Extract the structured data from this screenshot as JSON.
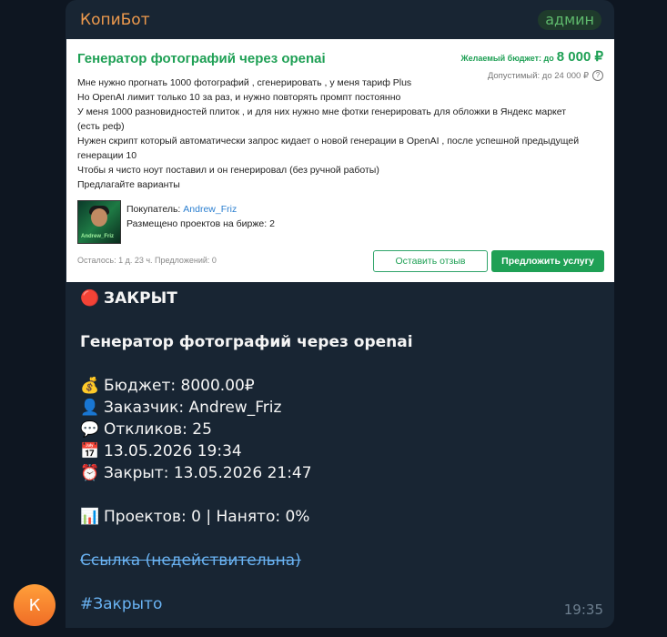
{
  "sender": {
    "name": "КопиБот",
    "badge": "админ",
    "avatar_letter": "К"
  },
  "card": {
    "title": "Генератор фотографий через openai",
    "budget_label": "Желаемый бюджет: до",
    "budget_value": "8 000 ₽",
    "allowed": "Допустимый: до 24 000 ₽",
    "help_icon": "?",
    "description": [
      "Мне нужно прогнать 1000 фотографий , сгенерировать , у меня тариф Plus",
      "Но OpenAI лимит только 10 за раз, и нужно повторять промпт постоянно",
      "У меня 1000 разновидностей плиток , и для них нужно мне фотки генерировать для обложки в Яндекс маркет",
      "(есть реф)",
      "Нужен скрипт который автоматически запрос кидает о новой генерации в OpenAI , после успешной предыдущей",
      "генерации 10",
      "Чтобы я чисто ноут поставил и он генерировал (без ручной работы)",
      "Предлагайте варианты"
    ],
    "buyer_label": "Покупатель: ",
    "buyer_name": "Andrew_Friz",
    "buyer_projects": "Размещено проектов на бирже: 2",
    "avatar_tag": "Andrew_Friz",
    "footer_meta": "Осталось: 1 д. 23 ч.   Предложений: 0",
    "btn_review": "Оставить отзыв",
    "btn_offer": "Предложить услугу"
  },
  "message": {
    "status_emoji": "🔴",
    "status": "ЗАКРЫТ",
    "title": "Генератор фотографий через openai",
    "lines": [
      {
        "emoji": "💰",
        "text": "Бюджет: 8000.00₽"
      },
      {
        "emoji": "👤",
        "text": "Заказчик: Andrew_Friz"
      },
      {
        "emoji": "💬",
        "text": "Откликов: 25"
      },
      {
        "emoji": "📅",
        "text": "13.05.2026 19:34"
      },
      {
        "emoji": "⏰",
        "text": "Закрыт: 13.05.2026 21:47"
      }
    ],
    "projects_emoji": "📊",
    "projects": "Проектов: 0 | Нанято: 0%",
    "link": "Ссылка (недействительна)",
    "hashtag": "#Закрыто",
    "time": "19:35"
  }
}
